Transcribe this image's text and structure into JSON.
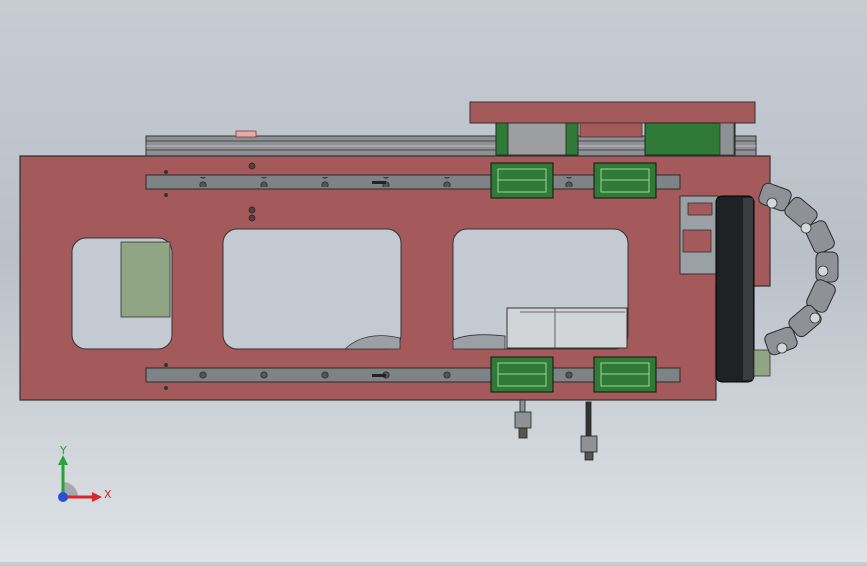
{
  "viewport": {
    "background_top": "#c6ccd3",
    "background_bottom": "#dfe3e7"
  },
  "model": {
    "part_color": "#a45a5a",
    "slider_block_color": "#2f7a36",
    "rail_color": "#7e8385",
    "cable_chain_color": "#8e9297",
    "motor_color": "#8fa583"
  },
  "triad": {
    "x_label": "X",
    "y_label": "Y",
    "x_color": "#d9262a",
    "y_color": "#27a33a",
    "z_color": "#2a4fd4"
  }
}
